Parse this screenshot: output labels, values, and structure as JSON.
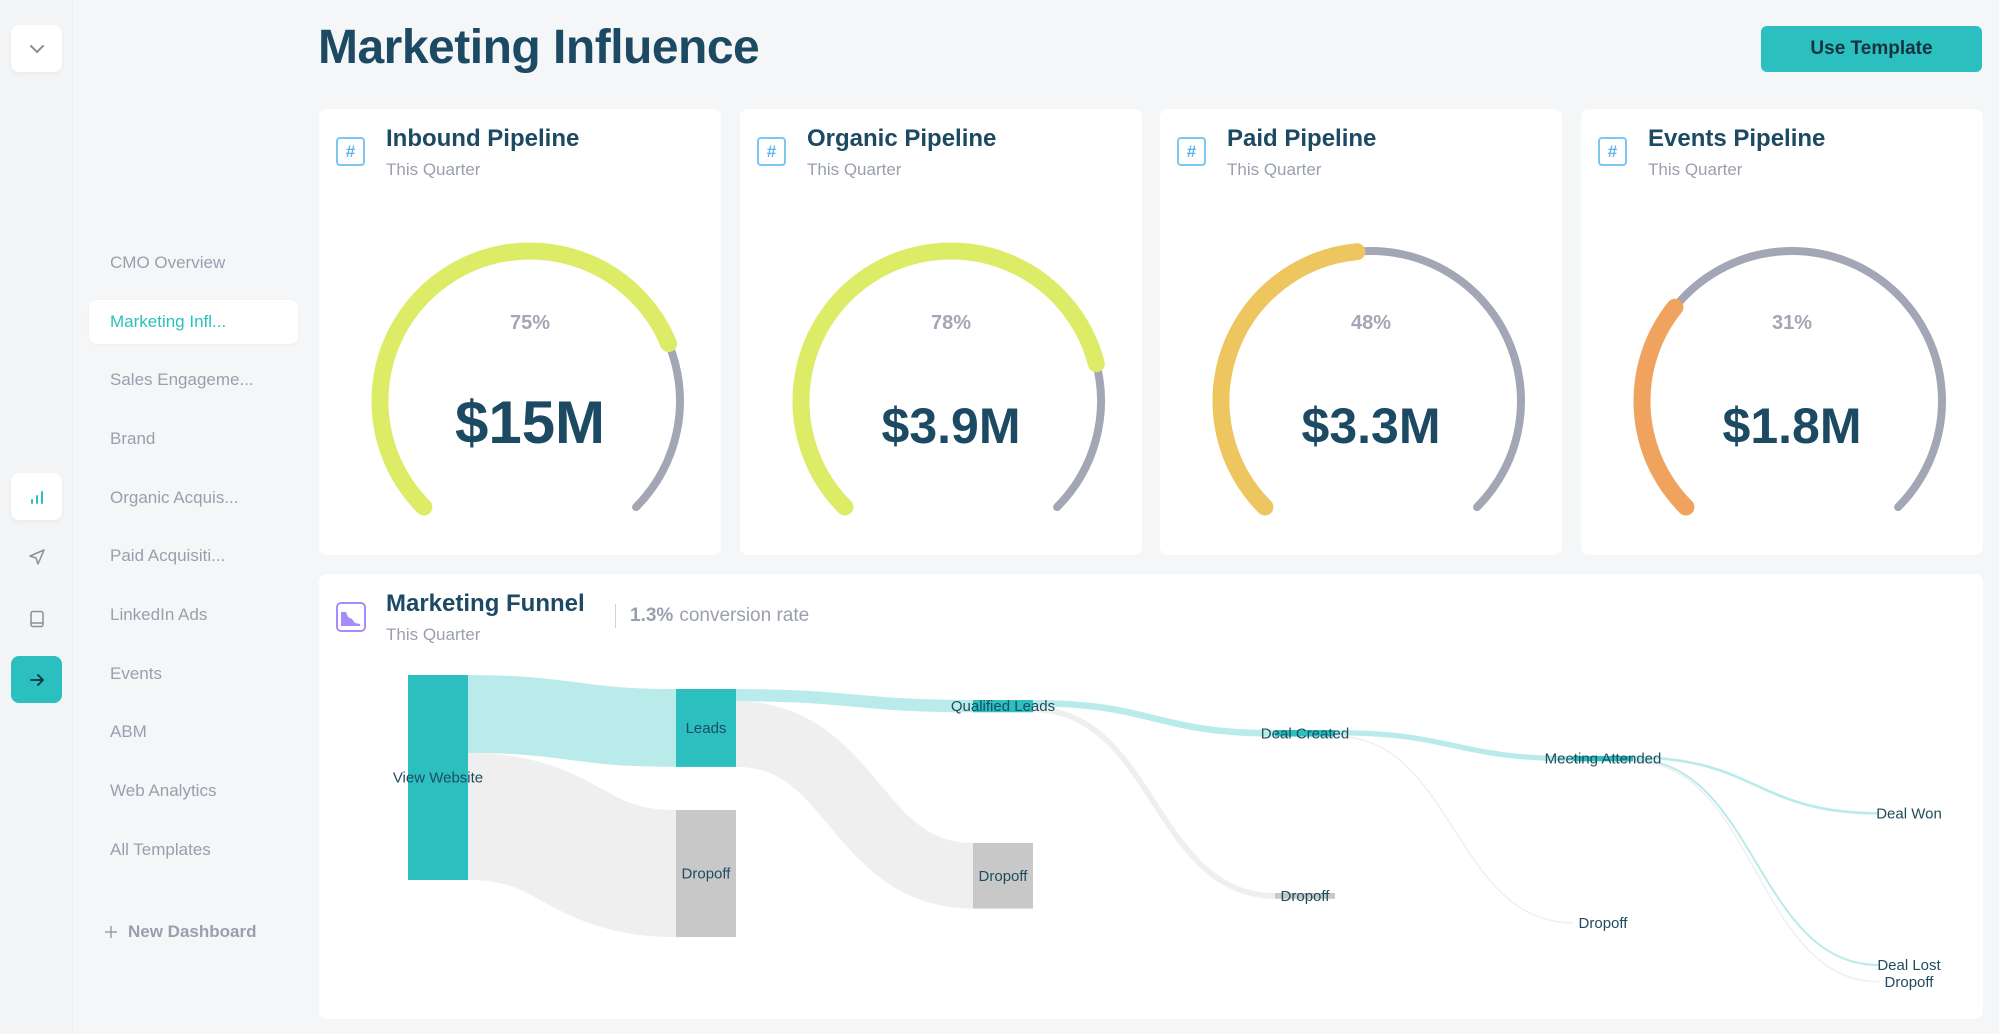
{
  "page": {
    "title": "Marketing Influence",
    "use_template_label": "Use Template"
  },
  "rail": {
    "items": [
      {
        "icon": "chevron-down-icon"
      },
      {
        "icon": "bar-chart-icon"
      },
      {
        "icon": "send-icon"
      },
      {
        "icon": "book-icon"
      },
      {
        "icon": "arrow-right-icon"
      }
    ]
  },
  "sidebar": {
    "items": [
      {
        "label": "CMO Overview"
      },
      {
        "label": "Marketing Infl...",
        "active": true
      },
      {
        "label": "Sales Engageme..."
      },
      {
        "label": "Brand"
      },
      {
        "label": "Organic Acquis..."
      },
      {
        "label": "Paid Acquisiti..."
      },
      {
        "label": "LinkedIn Ads"
      },
      {
        "label": "Events"
      },
      {
        "label": "ABM"
      },
      {
        "label": "Web Analytics"
      },
      {
        "label": "All Templates"
      }
    ],
    "new_dashboard_label": "New Dashboard"
  },
  "cards": [
    {
      "title": "Inbound Pipeline",
      "subtitle": "This Quarter",
      "percent_label": "75%",
      "percent": 75,
      "value": "$15M",
      "color": "#dcec66"
    },
    {
      "title": "Organic Pipeline",
      "subtitle": "This Quarter",
      "percent_label": "78%",
      "percent": 78,
      "value": "$3.9M",
      "color": "#dcec66"
    },
    {
      "title": "Paid Pipeline",
      "subtitle": "This Quarter",
      "percent_label": "48%",
      "percent": 48,
      "value": "$3.3M",
      "color": "#eec65f"
    },
    {
      "title": "Events Pipeline",
      "subtitle": "This Quarter",
      "percent_label": "31%",
      "percent": 31,
      "value": "$1.8M",
      "color": "#f0a35e"
    }
  ],
  "funnel": {
    "title": "Marketing Funnel",
    "subtitle": "This Quarter",
    "conversion_value": "1.3%",
    "conversion_label": "conversion rate"
  },
  "chart_data": {
    "type": "sankey",
    "title": "Marketing Funnel",
    "nodes": [
      {
        "id": "view",
        "label": "View Website",
        "stage": 0,
        "value": 100
      },
      {
        "id": "leads",
        "label": "Leads",
        "stage": 1,
        "value": 38
      },
      {
        "id": "drop1",
        "label": "Dropoff",
        "stage": 1,
        "value": 62
      },
      {
        "id": "ql",
        "label": "Qualified Leads",
        "stage": 2,
        "value": 6
      },
      {
        "id": "drop2",
        "label": "Dropoff",
        "stage": 2,
        "value": 32
      },
      {
        "id": "deal",
        "label": "Deal Created",
        "stage": 3,
        "value": 3.2
      },
      {
        "id": "drop3",
        "label": "Dropoff",
        "stage": 3,
        "value": 2.8
      },
      {
        "id": "meet",
        "label": "Meeting Attended",
        "stage": 4,
        "value": 2.6
      },
      {
        "id": "drop4",
        "label": "Dropoff",
        "stage": 4,
        "value": 0.6
      },
      {
        "id": "won",
        "label": "Deal Won",
        "stage": 5,
        "value": 1.3
      },
      {
        "id": "lost",
        "label": "Deal Lost",
        "stage": 5,
        "value": 1.0
      },
      {
        "id": "drop5",
        "label": "Dropoff",
        "stage": 5,
        "value": 0.3
      }
    ],
    "links": [
      {
        "source": "view",
        "target": "leads",
        "value": 38
      },
      {
        "source": "view",
        "target": "drop1",
        "value": 62
      },
      {
        "source": "leads",
        "target": "ql",
        "value": 6
      },
      {
        "source": "leads",
        "target": "drop2",
        "value": 32
      },
      {
        "source": "ql",
        "target": "deal",
        "value": 3.2
      },
      {
        "source": "ql",
        "target": "drop3",
        "value": 2.8
      },
      {
        "source": "deal",
        "target": "meet",
        "value": 2.6
      },
      {
        "source": "deal",
        "target": "drop4",
        "value": 0.6
      },
      {
        "source": "meet",
        "target": "won",
        "value": 1.3
      },
      {
        "source": "meet",
        "target": "lost",
        "value": 1.0
      },
      {
        "source": "meet",
        "target": "drop5",
        "value": 0.3
      }
    ],
    "colors": {
      "active": "#2bbfbf",
      "active_link": "#b9ebeb",
      "dropoff": "#c8c8c8",
      "dropoff_link": "#efefef"
    }
  }
}
